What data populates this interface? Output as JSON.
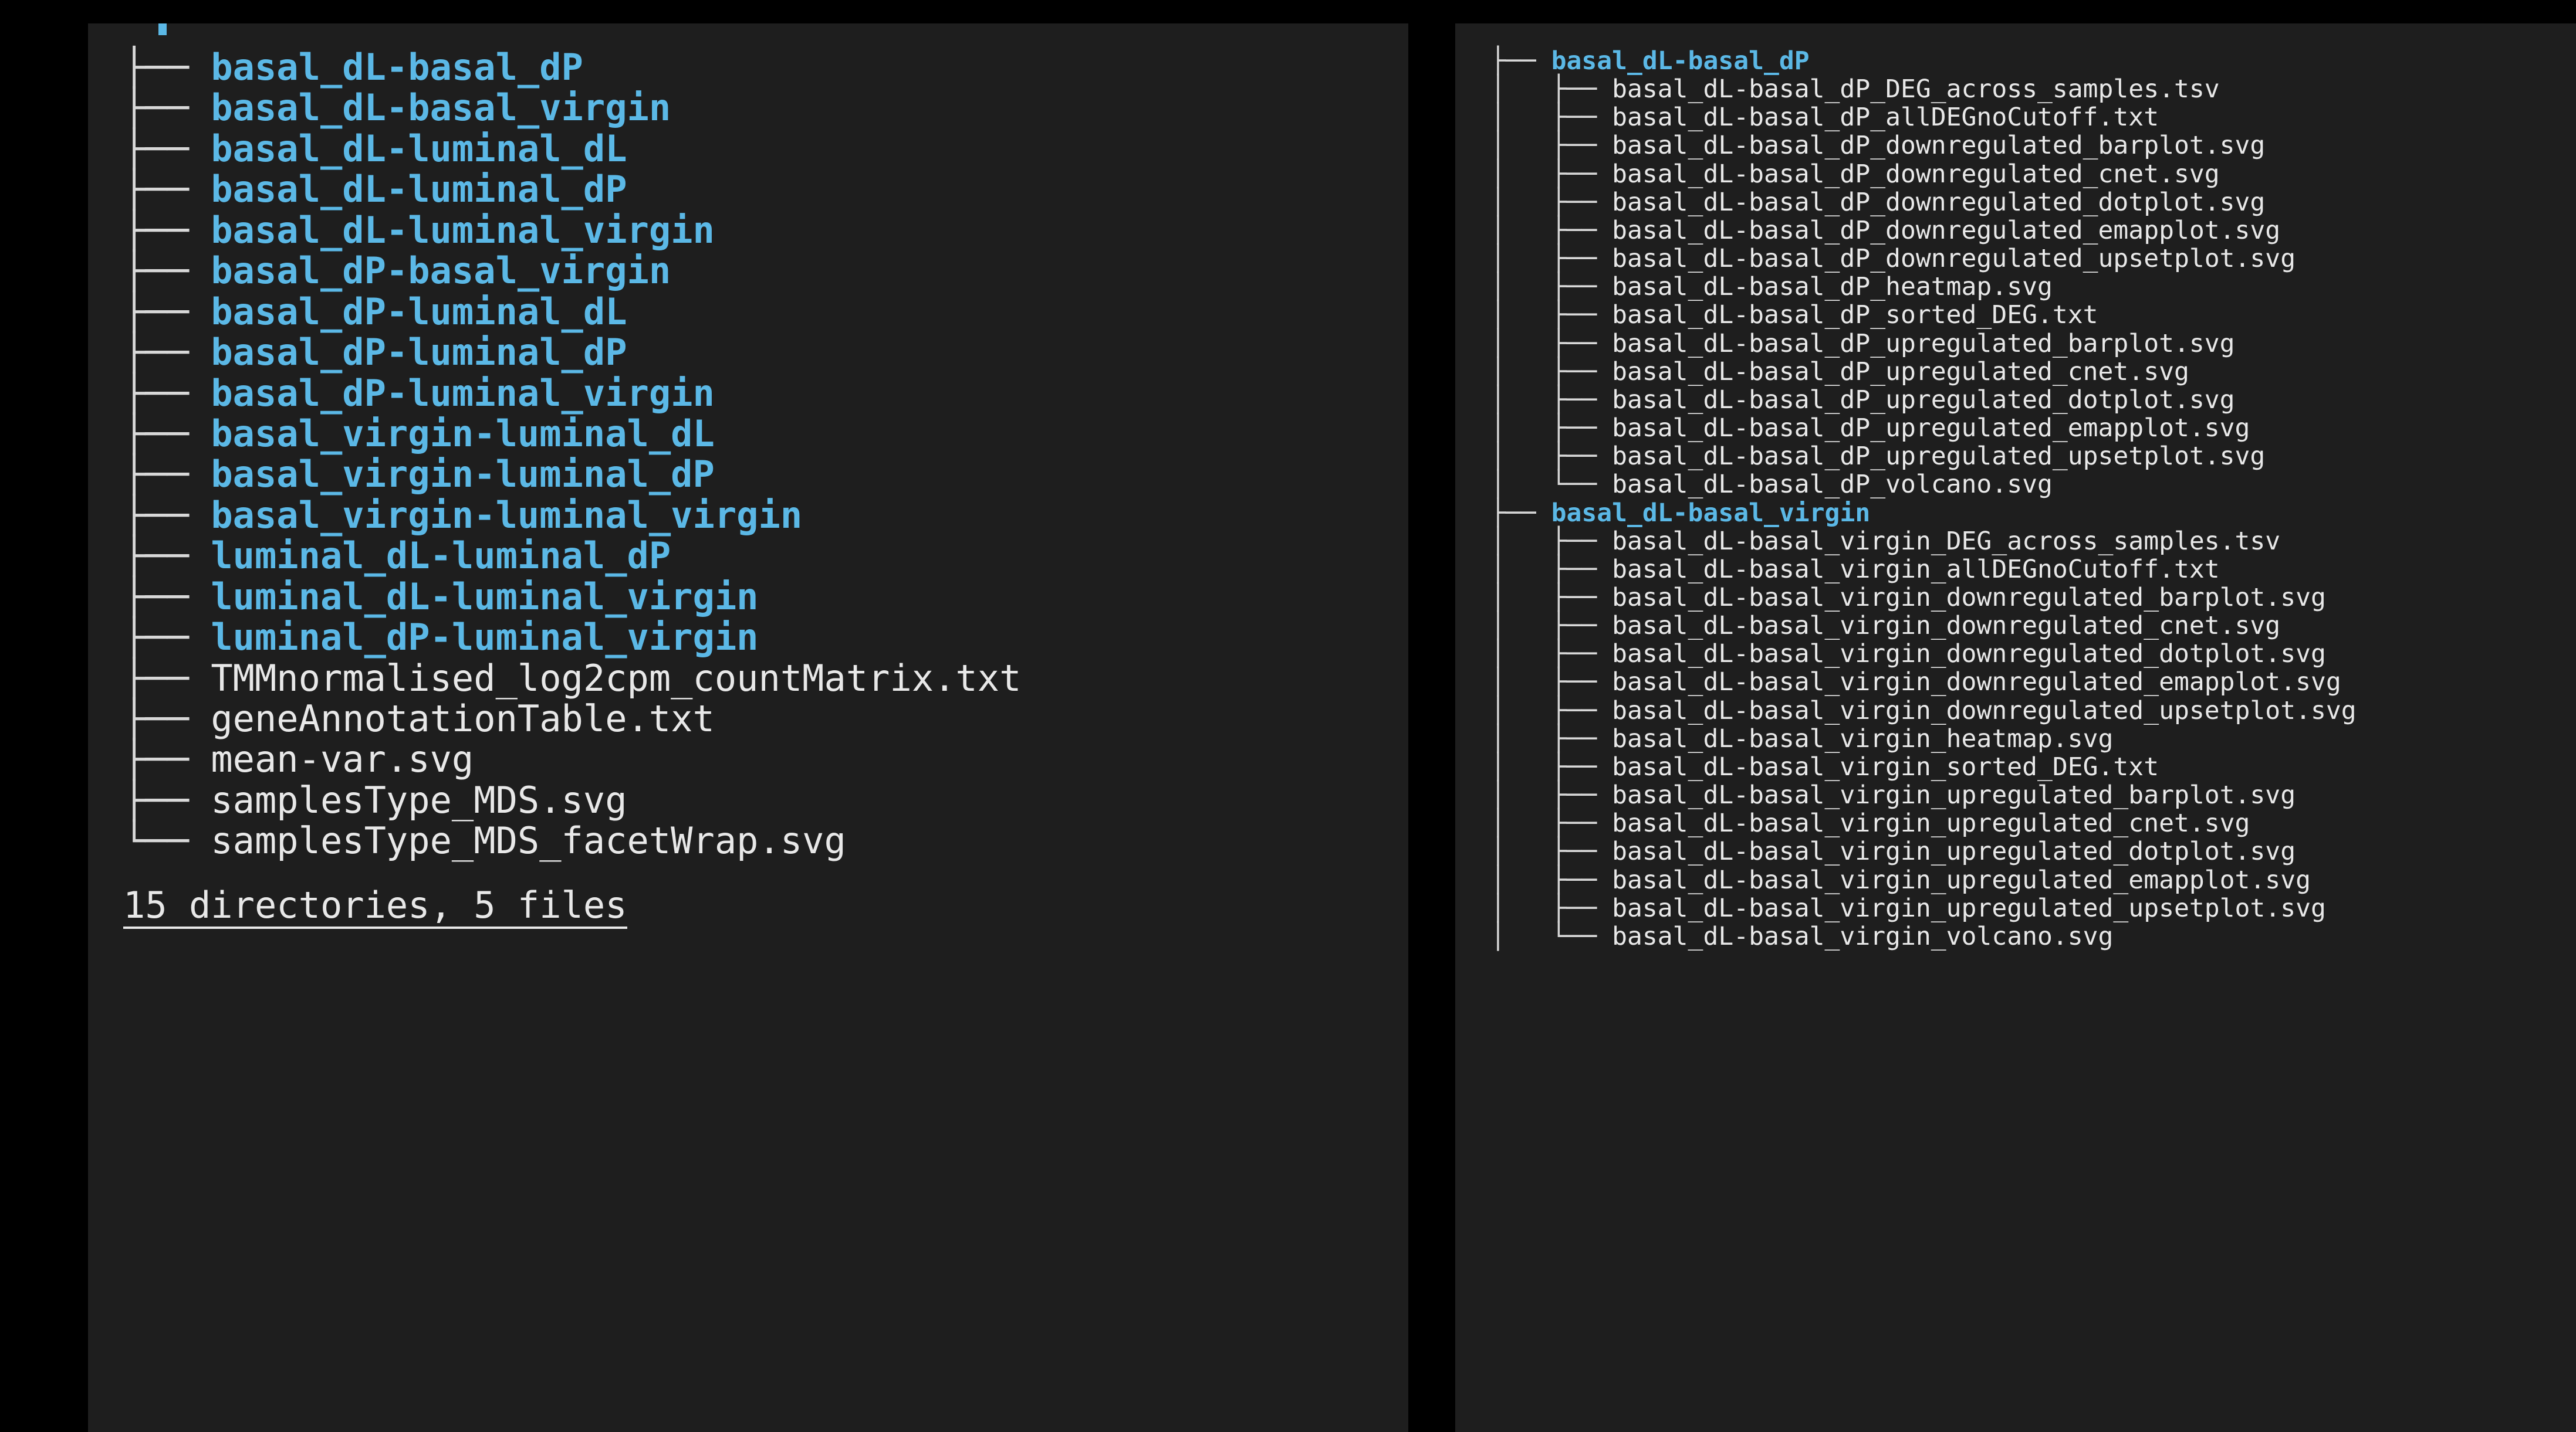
{
  "left": {
    "entries": [
      {
        "type": "dir",
        "prefix": "├── ",
        "name": "basal_dL-basal_dP"
      },
      {
        "type": "dir",
        "prefix": "├── ",
        "name": "basal_dL-basal_virgin"
      },
      {
        "type": "dir",
        "prefix": "├── ",
        "name": "basal_dL-luminal_dL"
      },
      {
        "type": "dir",
        "prefix": "├── ",
        "name": "basal_dL-luminal_dP"
      },
      {
        "type": "dir",
        "prefix": "├── ",
        "name": "basal_dL-luminal_virgin"
      },
      {
        "type": "dir",
        "prefix": "├── ",
        "name": "basal_dP-basal_virgin"
      },
      {
        "type": "dir",
        "prefix": "├── ",
        "name": "basal_dP-luminal_dL"
      },
      {
        "type": "dir",
        "prefix": "├── ",
        "name": "basal_dP-luminal_dP"
      },
      {
        "type": "dir",
        "prefix": "├── ",
        "name": "basal_dP-luminal_virgin"
      },
      {
        "type": "dir",
        "prefix": "├── ",
        "name": "basal_virgin-luminal_dL"
      },
      {
        "type": "dir",
        "prefix": "├── ",
        "name": "basal_virgin-luminal_dP"
      },
      {
        "type": "dir",
        "prefix": "├── ",
        "name": "basal_virgin-luminal_virgin"
      },
      {
        "type": "dir",
        "prefix": "├── ",
        "name": "luminal_dL-luminal_dP"
      },
      {
        "type": "dir",
        "prefix": "├── ",
        "name": "luminal_dL-luminal_virgin"
      },
      {
        "type": "dir",
        "prefix": "├── ",
        "name": "luminal_dP-luminal_virgin"
      },
      {
        "type": "file",
        "prefix": "├── ",
        "name": "TMMnormalised_log2cpm_countMatrix.txt"
      },
      {
        "type": "file",
        "prefix": "├── ",
        "name": "geneAnnotationTable.txt"
      },
      {
        "type": "file",
        "prefix": "├── ",
        "name": "mean-var.svg"
      },
      {
        "type": "file",
        "prefix": "├── ",
        "name": "samplesType_MDS.svg"
      },
      {
        "type": "file",
        "prefix": "└── ",
        "name": "samplesType_MDS_facetWrap.svg"
      }
    ],
    "summary": "15 directories, 5 files"
  },
  "right": {
    "entries": [
      {
        "type": "dir",
        "prefix": "├── ",
        "name": "basal_dL-basal_dP"
      },
      {
        "type": "file",
        "prefix": "│   ├── ",
        "name": "basal_dL-basal_dP_DEG_across_samples.tsv"
      },
      {
        "type": "file",
        "prefix": "│   ├── ",
        "name": "basal_dL-basal_dP_allDEGnoCutoff.txt"
      },
      {
        "type": "file",
        "prefix": "│   ├── ",
        "name": "basal_dL-basal_dP_downregulated_barplot.svg"
      },
      {
        "type": "file",
        "prefix": "│   ├── ",
        "name": "basal_dL-basal_dP_downregulated_cnet.svg"
      },
      {
        "type": "file",
        "prefix": "│   ├── ",
        "name": "basal_dL-basal_dP_downregulated_dotplot.svg"
      },
      {
        "type": "file",
        "prefix": "│   ├── ",
        "name": "basal_dL-basal_dP_downregulated_emapplot.svg"
      },
      {
        "type": "file",
        "prefix": "│   ├── ",
        "name": "basal_dL-basal_dP_downregulated_upsetplot.svg"
      },
      {
        "type": "file",
        "prefix": "│   ├── ",
        "name": "basal_dL-basal_dP_heatmap.svg"
      },
      {
        "type": "file",
        "prefix": "│   ├── ",
        "name": "basal_dL-basal_dP_sorted_DEG.txt"
      },
      {
        "type": "file",
        "prefix": "│   ├── ",
        "name": "basal_dL-basal_dP_upregulated_barplot.svg"
      },
      {
        "type": "file",
        "prefix": "│   ├── ",
        "name": "basal_dL-basal_dP_upregulated_cnet.svg"
      },
      {
        "type": "file",
        "prefix": "│   ├── ",
        "name": "basal_dL-basal_dP_upregulated_dotplot.svg"
      },
      {
        "type": "file",
        "prefix": "│   ├── ",
        "name": "basal_dL-basal_dP_upregulated_emapplot.svg"
      },
      {
        "type": "file",
        "prefix": "│   ├── ",
        "name": "basal_dL-basal_dP_upregulated_upsetplot.svg"
      },
      {
        "type": "file",
        "prefix": "│   └── ",
        "name": "basal_dL-basal_dP_volcano.svg"
      },
      {
        "type": "dir",
        "prefix": "├── ",
        "name": "basal_dL-basal_virgin"
      },
      {
        "type": "file",
        "prefix": "│   ├── ",
        "name": "basal_dL-basal_virgin_DEG_across_samples.tsv"
      },
      {
        "type": "file",
        "prefix": "│   ├── ",
        "name": "basal_dL-basal_virgin_allDEGnoCutoff.txt"
      },
      {
        "type": "file",
        "prefix": "│   ├── ",
        "name": "basal_dL-basal_virgin_downregulated_barplot.svg"
      },
      {
        "type": "file",
        "prefix": "│   ├── ",
        "name": "basal_dL-basal_virgin_downregulated_cnet.svg"
      },
      {
        "type": "file",
        "prefix": "│   ├── ",
        "name": "basal_dL-basal_virgin_downregulated_dotplot.svg"
      },
      {
        "type": "file",
        "prefix": "│   ├── ",
        "name": "basal_dL-basal_virgin_downregulated_emapplot.svg"
      },
      {
        "type": "file",
        "prefix": "│   ├── ",
        "name": "basal_dL-basal_virgin_downregulated_upsetplot.svg"
      },
      {
        "type": "file",
        "prefix": "│   ├── ",
        "name": "basal_dL-basal_virgin_heatmap.svg"
      },
      {
        "type": "file",
        "prefix": "│   ├── ",
        "name": "basal_dL-basal_virgin_sorted_DEG.txt"
      },
      {
        "type": "file",
        "prefix": "│   ├── ",
        "name": "basal_dL-basal_virgin_upregulated_barplot.svg"
      },
      {
        "type": "file",
        "prefix": "│   ├── ",
        "name": "basal_dL-basal_virgin_upregulated_cnet.svg"
      },
      {
        "type": "file",
        "prefix": "│   ├── ",
        "name": "basal_dL-basal_virgin_upregulated_dotplot.svg"
      },
      {
        "type": "file",
        "prefix": "│   ├── ",
        "name": "basal_dL-basal_virgin_upregulated_emapplot.svg"
      },
      {
        "type": "file",
        "prefix": "│   ├── ",
        "name": "basal_dL-basal_virgin_upregulated_upsetplot.svg"
      },
      {
        "type": "file",
        "prefix": "│   └── ",
        "name": "basal_dL-basal_virgin_volcano.svg"
      }
    ]
  }
}
